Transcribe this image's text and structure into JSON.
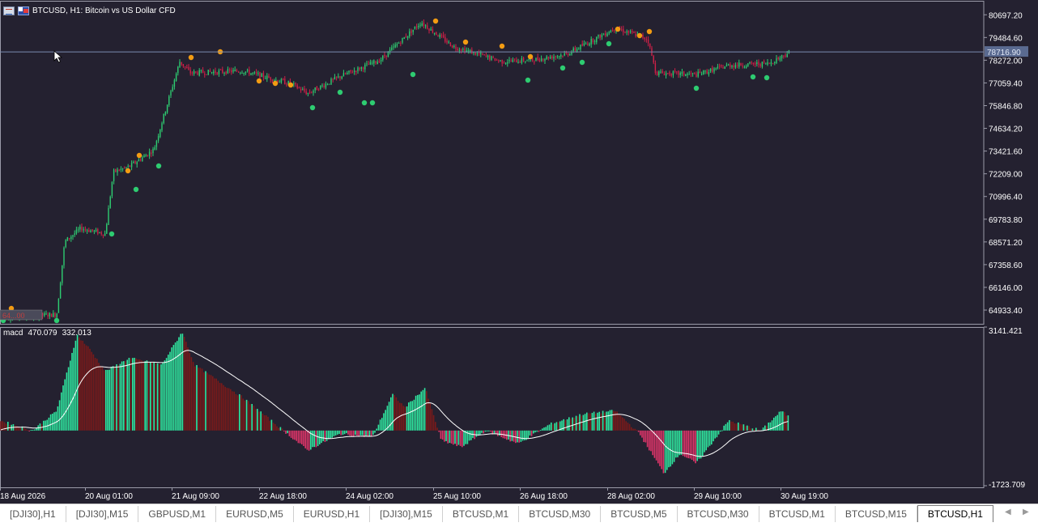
{
  "window": {
    "symbol_title": "BTCUSD, H1:  Bitcoin vs US Dollar CFD",
    "grid_icon": "chart-grid-icon",
    "symbol_icon": "symbol-flag-icon"
  },
  "price_axis": {
    "labels": [
      "80697.20",
      "79484.60",
      "78272.00",
      "77059.40",
      "75846.80",
      "74634.20",
      "73421.60",
      "72209.00",
      "70996.40",
      "69783.80",
      "68571.20",
      "67358.60",
      "66146.00",
      "64933.40"
    ],
    "current_price": "78716.90",
    "left_price_tag": "64...00"
  },
  "macd": {
    "name": "macd",
    "value_main": "470.079",
    "value_signal": "332.013",
    "axis_top": "3141.421",
    "axis_bottom": "-1723.709",
    "colors": {
      "up_strong": "#2fe8a0",
      "up": "#1a7a2a",
      "down_strong": "#e0356a",
      "down": "#7a1a1a",
      "signal": "#ffffff"
    }
  },
  "time_axis": {
    "labels": [
      "18 Aug 2026",
      "20 Aug 01:00",
      "21 Aug 09:00",
      "22 Aug 18:00",
      "24 Aug 02:00",
      "25 Aug 10:00",
      "26 Aug 18:00",
      "28 Aug 02:00",
      "29 Aug 10:00",
      "30 Aug 19:00"
    ]
  },
  "colors": {
    "background": "#242130",
    "candle_up": "#2ecc71",
    "candle_down": "#d02048",
    "fractal_up": "#f39c12",
    "fractal_down": "#2ecc71",
    "price_line": "#7a8bb0"
  },
  "chart_data": {
    "type": "line",
    "series": [
      {
        "x": [
          "18 Aug 2026",
          "20 Aug 01:00",
          "21 Aug 09:00",
          "22 Aug 18:00",
          "24 Aug 02:00",
          "25 Aug 10:00",
          "26 Aug 18:00",
          "28 Aug 02:00",
          "29 Aug 10:00",
          "30 Aug 19:00"
        ],
        "values": [
          64530,
          68850,
          78100,
          77450,
          78150,
          79500,
          78600,
          79800,
          77500,
          78717
        ]
      }
    ],
    "ylim": [
      64200,
      81400
    ],
    "macd_ylim": [
      -1723.709,
      3141.421
    ],
    "grid": false
  },
  "tabs": {
    "items": [
      "[DJI30],H1",
      "[DJI30],M15",
      "GBPUSD,M1",
      "EURUSD,M5",
      "EURUSD,H1",
      "[DJI30],M15",
      "BTCUSD,M1",
      "BTCUSD,M30",
      "BTCUSD,M5",
      "BTCUSD,M30",
      "BTCUSD,M1",
      "BTCUSD,M15",
      "BTCUSD,H1"
    ],
    "active_index": 12,
    "prev": "◀",
    "next": "▶"
  }
}
